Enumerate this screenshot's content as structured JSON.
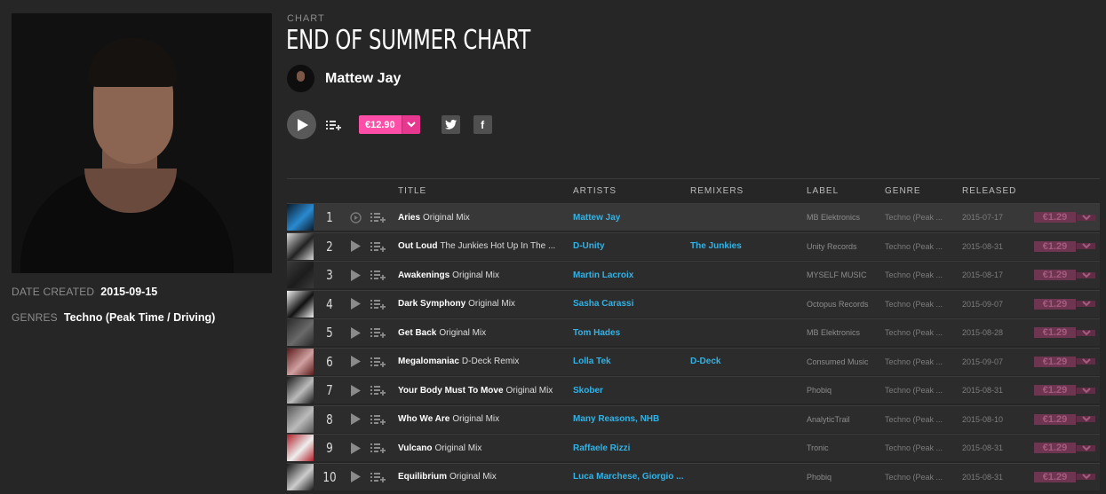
{
  "chart": {
    "section_label": "CHART",
    "title": "END OF SUMMER CHART",
    "artist": "Mattew Jay",
    "price": "€12.90"
  },
  "meta": {
    "date_label": "DATE CREATED",
    "date_value": "2015-09-15",
    "genres_label": "GENRES",
    "genres_value": "Techno (Peak Time / Driving)"
  },
  "social": {
    "twitter": "twitter-icon",
    "facebook": "facebook-icon",
    "facebook_glyph": "f"
  },
  "table": {
    "headers": {
      "title": "TITLE",
      "artists": "ARTISTS",
      "remixers": "REMIXERS",
      "label": "LABEL",
      "genre": "GENRE",
      "released": "RELEASED"
    },
    "rows": [
      {
        "num": "1",
        "name": "Aries",
        "mix": "Original Mix",
        "artists": "Mattew Jay",
        "remixers": "",
        "label": "MB Elektronics",
        "genre": "Techno (Peak ...",
        "released": "2015-07-17",
        "price": "€1.29"
      },
      {
        "num": "2",
        "name": "Out Loud",
        "mix": "The Junkies Hot Up In The ...",
        "artists": "D-Unity",
        "remixers": "The Junkies",
        "label": "Unity Records",
        "genre": "Techno (Peak ...",
        "released": "2015-08-31",
        "price": "€1.29"
      },
      {
        "num": "3",
        "name": "Awakenings",
        "mix": "Original Mix",
        "artists": "Martin Lacroix",
        "remixers": "",
        "label": "MYSELF MUSIC",
        "genre": "Techno (Peak ...",
        "released": "2015-08-17",
        "price": "€1.29"
      },
      {
        "num": "4",
        "name": "Dark Symphony",
        "mix": "Original Mix",
        "artists": "Sasha Carassi",
        "remixers": "",
        "label": "Octopus Records",
        "genre": "Techno (Peak ...",
        "released": "2015-09-07",
        "price": "€1.29"
      },
      {
        "num": "5",
        "name": "Get Back",
        "mix": "Original Mix",
        "artists": "Tom Hades",
        "remixers": "",
        "label": "MB Elektronics",
        "genre": "Techno (Peak ...",
        "released": "2015-08-28",
        "price": "€1.29"
      },
      {
        "num": "6",
        "name": "Megalomaniac",
        "mix": "D-Deck Remix",
        "artists": "Lolla Tek",
        "remixers": "D-Deck",
        "label": "Consumed Music",
        "genre": "Techno (Peak ...",
        "released": "2015-09-07",
        "price": "€1.29"
      },
      {
        "num": "7",
        "name": "Your Body Must To Move",
        "mix": "Original Mix",
        "artists": "Skober",
        "remixers": "",
        "label": "Phobiq",
        "genre": "Techno (Peak ...",
        "released": "2015-08-31",
        "price": "€1.29"
      },
      {
        "num": "8",
        "name": "Who We Are",
        "mix": "Original Mix",
        "artists": "Many Reasons, NHB",
        "remixers": "",
        "label": "AnalyticTrail",
        "genre": "Techno (Peak ...",
        "released": "2015-08-10",
        "price": "€1.29"
      },
      {
        "num": "9",
        "name": "Vulcano",
        "mix": "Original Mix",
        "artists": "Raffaele Rizzi",
        "remixers": "",
        "label": "Tronic",
        "genre": "Techno (Peak ...",
        "released": "2015-08-31",
        "price": "€1.29"
      },
      {
        "num": "10",
        "name": "Equilibrium",
        "mix": "Original Mix",
        "artists": "Luca Marchese, Giorgio ...",
        "remixers": "",
        "label": "Phobiq",
        "genre": "Techno (Peak ...",
        "released": "2015-08-31",
        "price": "€1.29"
      }
    ]
  },
  "colors": {
    "accent": "#ff4ea7",
    "link": "#33b2e5",
    "background": "#262626"
  }
}
